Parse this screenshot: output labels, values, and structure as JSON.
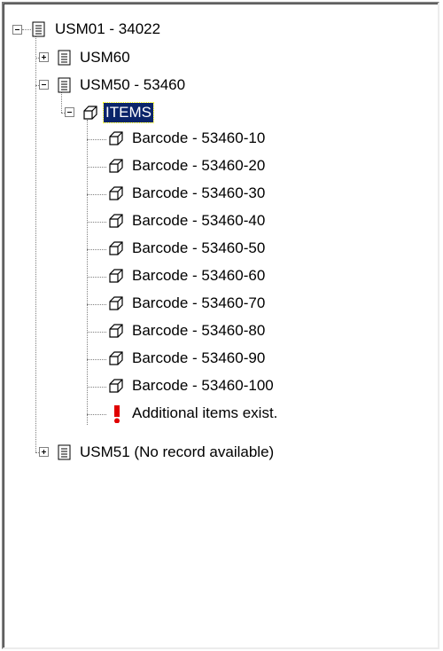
{
  "tree": {
    "root": {
      "label": "USM01 - 34022",
      "icon": "record-icon",
      "expanded": true,
      "children": [
        {
          "label": "USM60",
          "icon": "record-icon",
          "expanded": false
        },
        {
          "label": "USM50 - 53460",
          "icon": "record-icon",
          "expanded": true,
          "items_folder": {
            "label": "ITEMS",
            "icon": "cube-icon",
            "expanded": true,
            "selected": true,
            "items": [
              {
                "label": "Barcode - 53460-10",
                "icon": "cube-icon"
              },
              {
                "label": "Barcode - 53460-20",
                "icon": "cube-icon"
              },
              {
                "label": "Barcode - 53460-30",
                "icon": "cube-icon"
              },
              {
                "label": "Barcode - 53460-40",
                "icon": "cube-icon"
              },
              {
                "label": "Barcode - 53460-50",
                "icon": "cube-icon"
              },
              {
                "label": "Barcode - 53460-60",
                "icon": "cube-icon"
              },
              {
                "label": "Barcode - 53460-70",
                "icon": "cube-icon"
              },
              {
                "label": "Barcode - 53460-80",
                "icon": "cube-icon"
              },
              {
                "label": "Barcode - 53460-90",
                "icon": "cube-icon"
              },
              {
                "label": "Barcode - 53460-100",
                "icon": "cube-icon"
              }
            ],
            "notice": {
              "label": "Additional items exist.",
              "icon": "exclamation-icon",
              "color": "#e00000"
            }
          }
        },
        {
          "label": "USM51 (No record available)",
          "icon": "record-icon",
          "expanded": false
        }
      ]
    },
    "colors": {
      "selection_bg": "#0a246a",
      "selection_fg": "#ffffff",
      "tree_lines": "#808080"
    }
  }
}
